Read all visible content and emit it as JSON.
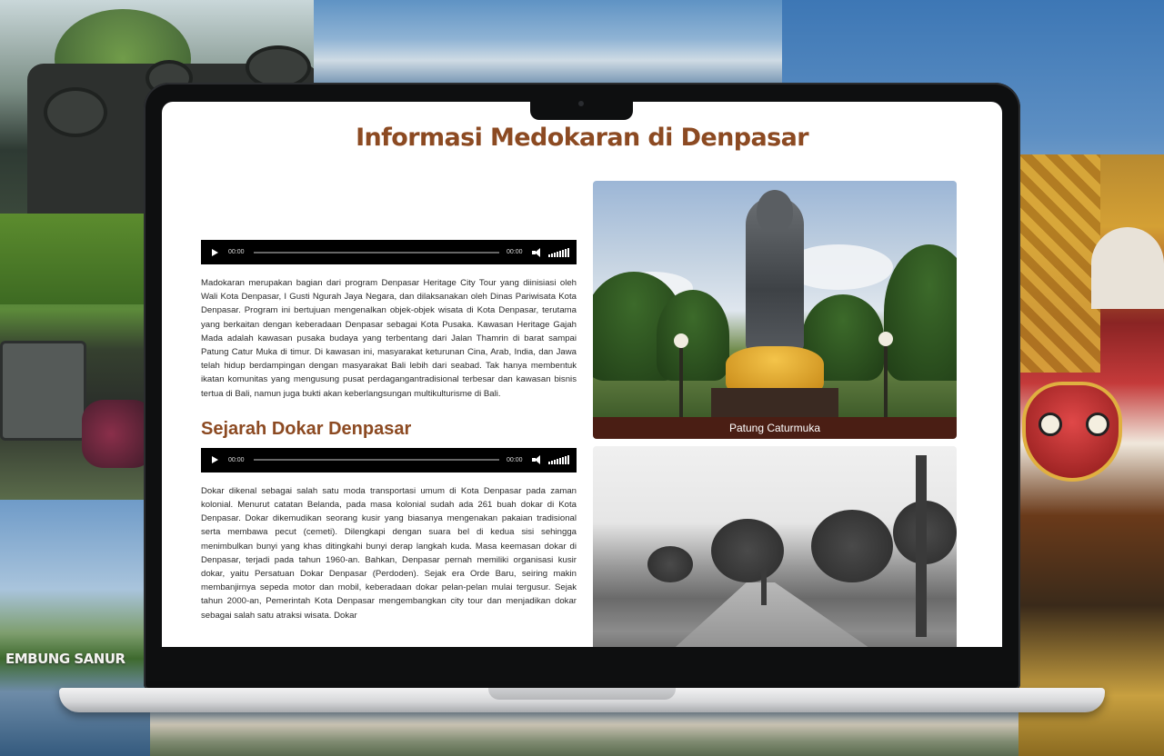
{
  "background": {
    "signage_text": "EMBUNG SANUR"
  },
  "page": {
    "title": "Informasi Medokaran di Denpasar"
  },
  "audio_players": [
    {
      "current_time": "00:00",
      "duration": "00:00"
    },
    {
      "current_time": "00:00",
      "duration": "00:00"
    }
  ],
  "intro": {
    "text": "Madokaran merupakan bagian dari program Denpasar Heritage City Tour yang diinisiasi oleh Wali Kota Denpasar, I Gusti Ngurah Jaya Negara, dan dilaksanakan oleh Dinas Pariwisata Kota Denpasar. Program ini bertujuan mengenalkan objek-objek wisata di Kota Denpasar, terutama yang berkaitan dengan keberadaan Denpasar sebagai Kota Pusaka. Kawasan Heritage Gajah Mada adalah kawasan pusaka budaya yang terbentang dari Jalan Thamrin di barat sampai Patung Catur Muka di timur. Di kawasan ini, masyarakat keturunan Cina, Arab, India, dan Jawa telah hidup berdampingan dengan masyarakat Bali lebih dari seabad. Tak hanya membentuk ikatan komunitas yang mengusung pusat perdagangantradisional terbesar dan kawasan bisnis tertua di Bali, namun juga bukti akan keberlangsungan multikulturisme di Bali."
  },
  "history": {
    "title": "Sejarah Dokar Denpasar",
    "text": "Dokar dikenal sebagai salah satu moda transportasi umum di Kota Denpasar pada zaman kolonial. Menurut catatan Belanda, pada masa kolonial sudah ada 261 buah dokar di Kota Denpasar. Dokar dikemudikan seorang kusir yang biasanya mengenakan pakaian tradisional serta membawa pecut (cemeti). Dilengkapi dengan suara bel di kedua sisi sehingga menimbulkan bunyi yang khas ditingkahi bunyi derap langkah kuda. Masa keemasan dokar di Denpasar, terjadi pada tahun 1960-an. Bahkan, Denpasar pernah memiliki organisasi kusir dokar, yaitu Persatuan Dokar Denpasar (Perdoden). Sejak era Orde Baru, seiring makin membanjirnya sepeda motor dan mobil, keberadaan dokar pelan-pelan mulai tergusur. Sejak tahun 2000-an, Pemerintah Kota Denpasar mengembangkan city tour dan menjadikan dokar sebagai salah satu atraksi wisata. Dokar"
  },
  "gallery": [
    {
      "caption": "Patung Caturmuka"
    }
  ],
  "colors": {
    "heading": "#8c4a22",
    "caption_bg": "#4a1e14",
    "audio_bg": "#000000"
  }
}
